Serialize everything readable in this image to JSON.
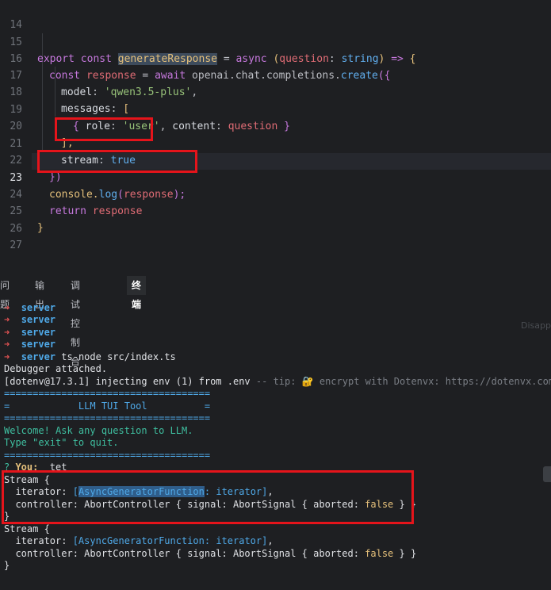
{
  "editor": {
    "line_numbers": [
      "14",
      "15",
      "16",
      "17",
      "18",
      "19",
      "20",
      "21",
      "22",
      "23",
      "24",
      "25",
      "26",
      "27"
    ],
    "active_line": "23",
    "tokens": {
      "export": "export",
      "const": "const",
      "generateResponse": "generateResponse",
      "eq": " = ",
      "async": "async",
      "param_open": " (",
      "question": "question",
      "colon_sp": ": ",
      "string": "string",
      "param_close": ") ",
      "arrow": "=>",
      "open_brace": " {",
      "response": "response",
      "await": "await",
      "openai_call": "openai.chat.completions.",
      "create": "create",
      "paren_obj_open": "({",
      "model_key": "model",
      "model_val": "'qwen3.5-plus'",
      "comma": ",",
      "messages_key": "messages",
      "bracket_open": "[",
      "obj_open": "{ ",
      "role_key": "role",
      "role_val": "'user'",
      "content_key": "content",
      "obj_close": " }",
      "bracket_close": "],",
      "stream_key": "stream",
      "stream_val": "true",
      "close_call": "})",
      "console_log": "console.",
      "log": "log",
      "paren_open": "(",
      "paren_close": ");",
      "return": "return",
      "close_fn": "}"
    }
  },
  "panel": {
    "tabs": [
      "问题",
      "输出",
      "调试控制台",
      "终端"
    ],
    "active_tab": "终端",
    "side_hint": "Disapp"
  },
  "terminal": {
    "arrow": "➜",
    "server": "server",
    "cmd": " ts-node src/index.ts",
    "debugger": "Debugger attached.",
    "dotenv_a": "[dotenv@17.3.1] injecting env (1) from .env ",
    "dotenv_b": "-- tip: 🔐 encrypt with Dotenvx: https://dotenvx.com",
    "rule": "====================================",
    "title_line": "=            LLM TUI Tool          =",
    "welcome": "Welcome! Ask any question to LLM.",
    "quit": "Type \"exit\" to quit.",
    "prompt_q": "? ",
    "prompt_you": "You:",
    "prompt_answer": "  tet",
    "stream_open": "Stream {",
    "iterator_key": "  iterator: ",
    "agf_open": "[",
    "agf_sel": "AsyncGeneratorFunction",
    "agf_rest": ": iterator]",
    "agf_full": "[AsyncGeneratorFunction: iterator]",
    "comma": ",",
    "controller_a": "  controller: AbortController { signal: AbortSignal { aborted: ",
    "false": "false",
    "controller_b": " } }",
    "close": "}"
  }
}
